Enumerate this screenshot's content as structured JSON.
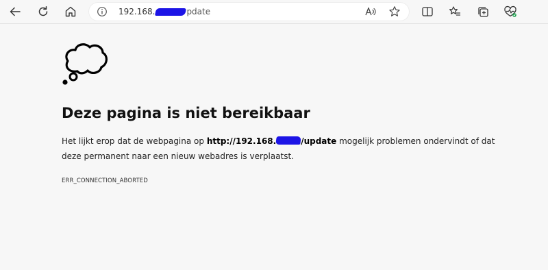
{
  "browser": {
    "url_visible_start": "192.168.",
    "url_visible_end": "pdate",
    "redaction_color": "#1c14e6",
    "icons": [
      "back-arrow-icon",
      "refresh-icon",
      "home-icon",
      "info-icon",
      "read-aloud-icon",
      "favorite-star-icon",
      "split-screen-icon",
      "favorites-list-icon",
      "collections-icon",
      "browser-essentials-icon"
    ]
  },
  "error": {
    "title": "Deze pagina is niet bereikbaar",
    "desc_before": "Het lijkt erop dat de webpagina op ",
    "desc_url_start": "http://192.168.",
    "desc_url_end": "/update",
    "desc_after": " mogelijk problemen ondervindt of dat deze permanent naar een nieuw webadres is verplaatst.",
    "code": "ERR_CONNECTION_ABORTED"
  }
}
